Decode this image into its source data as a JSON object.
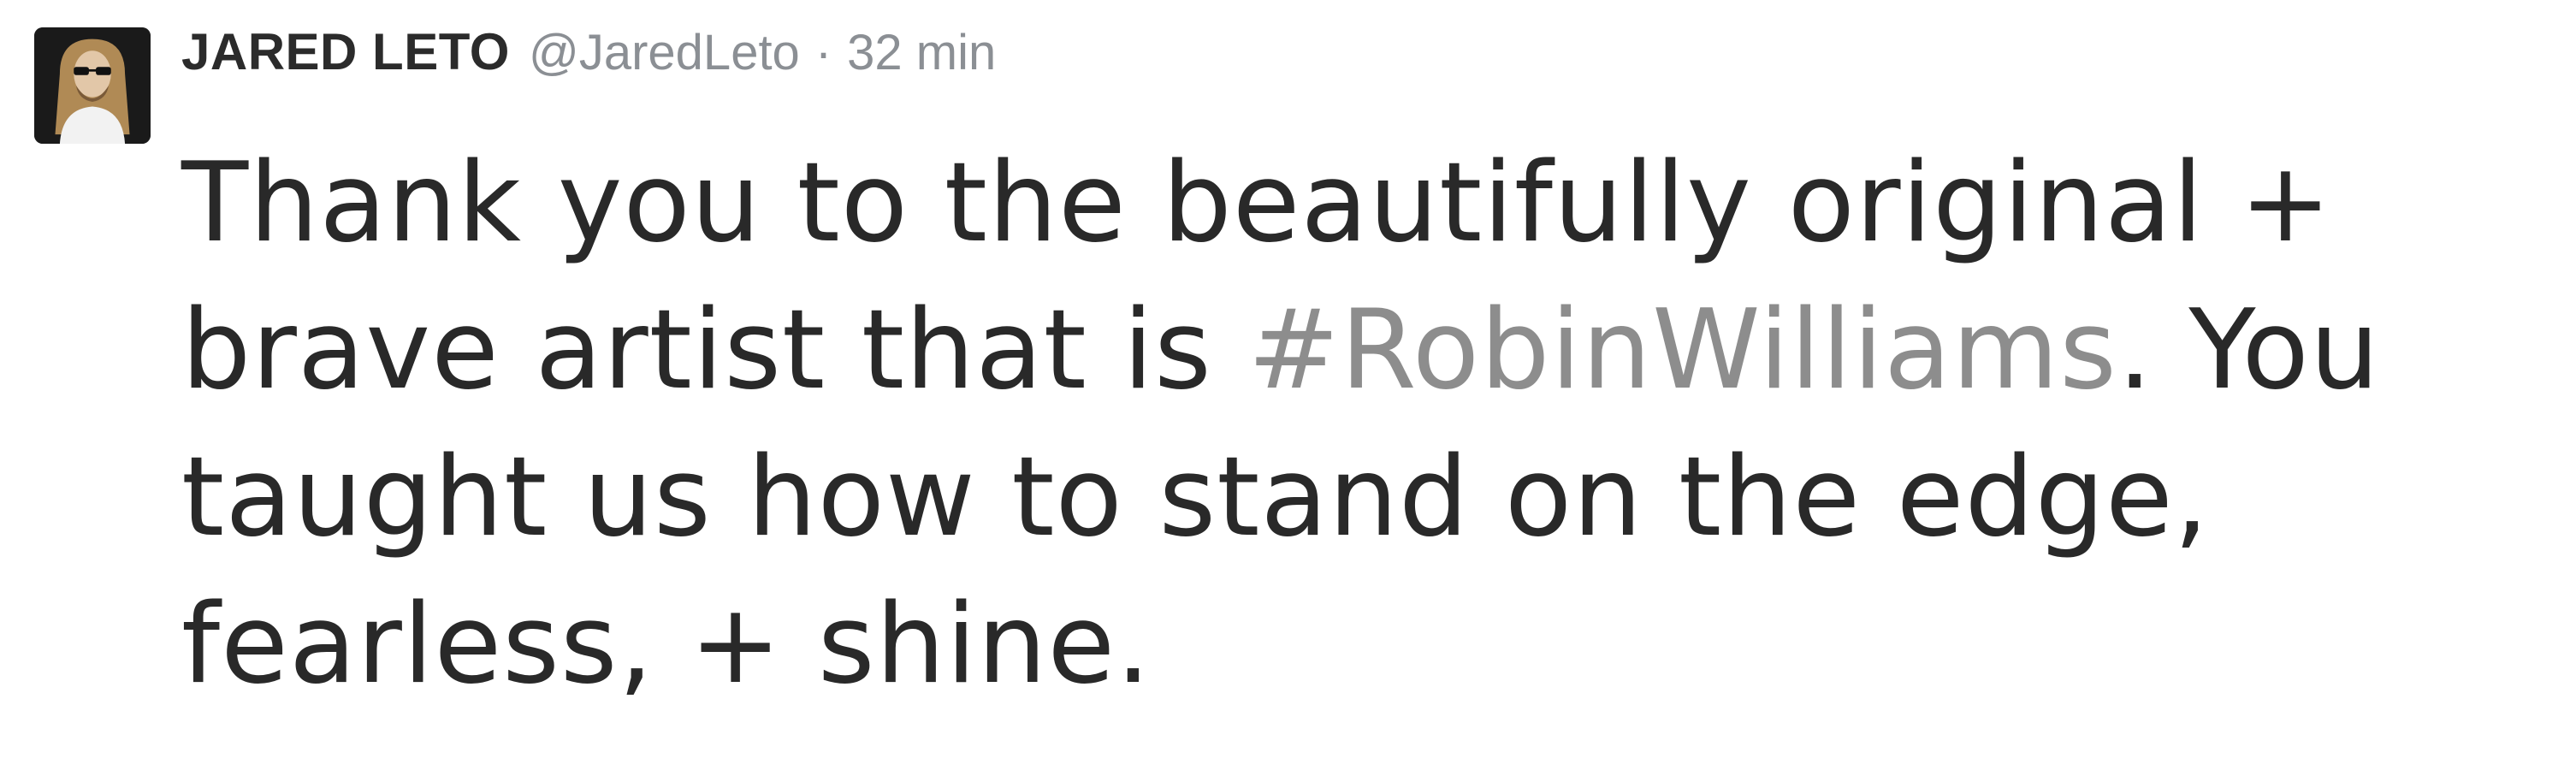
{
  "tweet": {
    "author_name": "JARED LETO",
    "author_handle": "@JaredLeto",
    "separator": "·",
    "timestamp": "32 min",
    "avatar_icon": "profile-photo",
    "text": {
      "line1": "Thank you to the beautifully original +",
      "line2_before": "brave artist that is ",
      "line2_hashtag": "#RobinWilliams",
      "line2_after": ". You",
      "line3": "taught us how to stand on the edge,",
      "line4": "fearless, + shine."
    },
    "colors": {
      "text": "#292929",
      "muted": "#8b8f94",
      "hashtag": "#8d8d8d",
      "background": "#ffffff"
    }
  }
}
